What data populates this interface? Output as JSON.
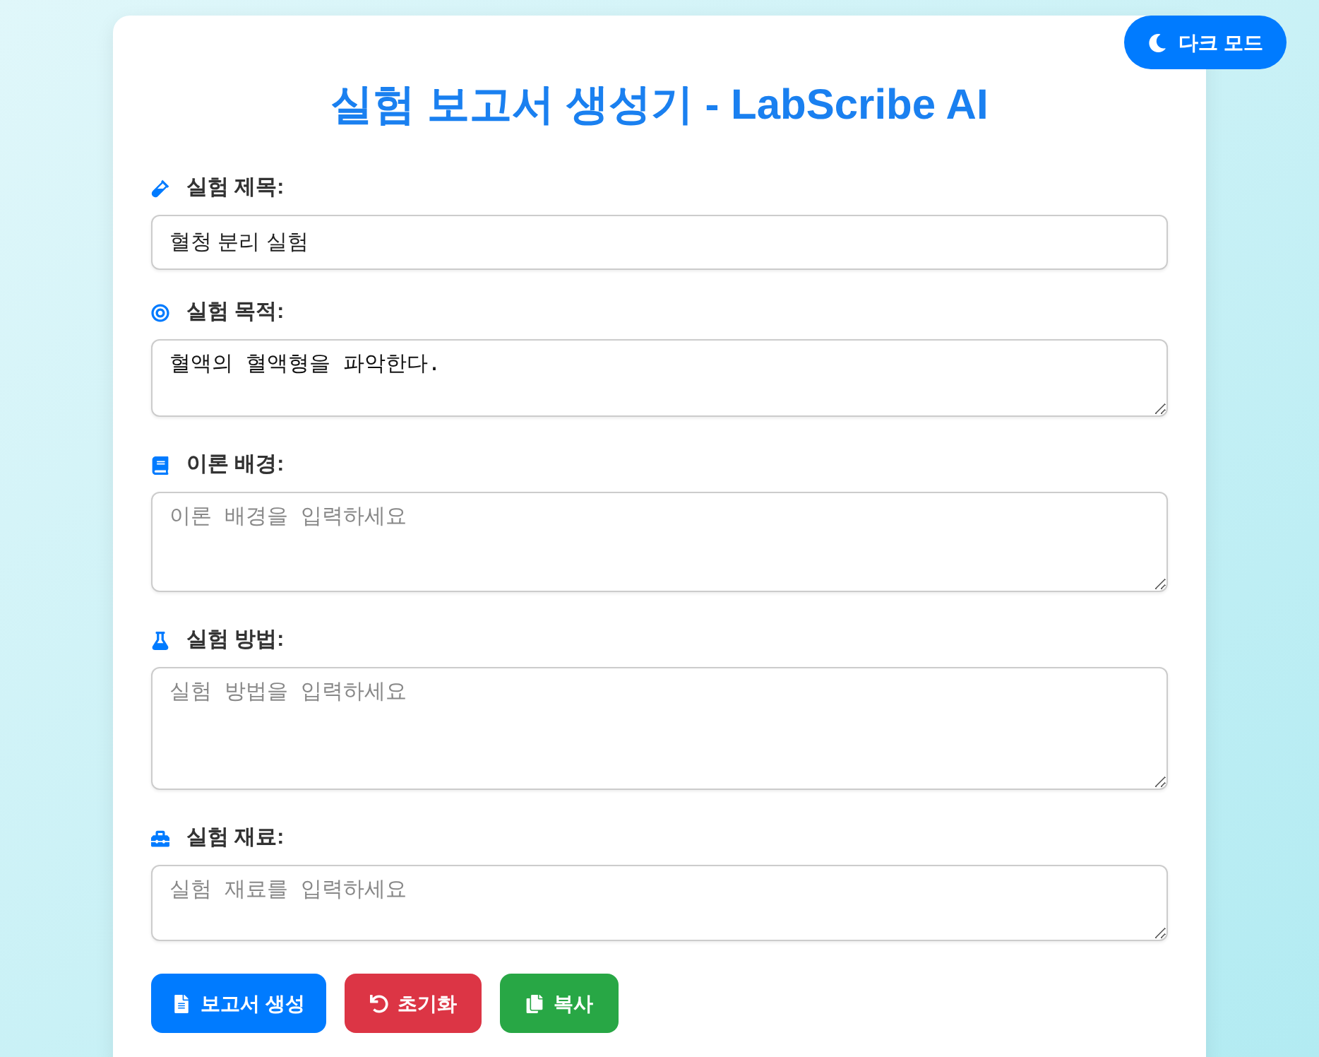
{
  "dark_mode_button": {
    "label": "다크 모드"
  },
  "title": "실험 보고서 생성기 - LabScribe AI",
  "fields": [
    {
      "kind": "input",
      "label": "실험 제목:",
      "value": "혈청 분리 실험"
    },
    {
      "kind": "textarea",
      "label": "실험 목적:",
      "value": "혈액의 혈액형을 파악한다."
    },
    {
      "kind": "textarea",
      "label": "이론 배경:",
      "placeholder": "이론 배경을 입력하세요"
    },
    {
      "kind": "textarea",
      "label": "실험 방법:",
      "placeholder": "실험 방법을 입력하세요"
    },
    {
      "kind": "textarea",
      "label": "실험 재료:",
      "placeholder": "실험 재료를 입력하세요"
    }
  ],
  "buttons": [
    {
      "kind": "generate",
      "label": "보고서 생성"
    },
    {
      "kind": "reset",
      "label": "초기화"
    },
    {
      "kind": "copy",
      "label": "복사"
    }
  ]
}
